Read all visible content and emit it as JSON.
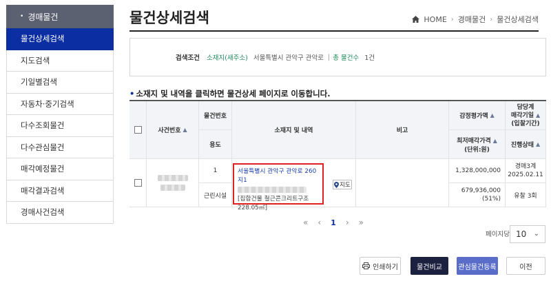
{
  "sidebar": {
    "header": "경매물건",
    "items": [
      {
        "label": "물건상세검색",
        "active": true
      },
      {
        "label": "지도검색"
      },
      {
        "label": "기일별검색"
      },
      {
        "label": "자동차·중기검색"
      },
      {
        "label": "다수조회물건"
      },
      {
        "label": "다수관심물건"
      },
      {
        "label": "매각예정물건"
      },
      {
        "label": "매각결과검색"
      },
      {
        "label": "경매사건검색"
      }
    ]
  },
  "header": {
    "title": "물건상세검색",
    "breadcrumb": [
      "HOME",
      "경매물건",
      "물건상세검색"
    ]
  },
  "search_condition": {
    "label": "검색조건",
    "location_key": "소재지(새주소)",
    "location_value": "서울특별시 관악구 관악로",
    "count_key": "총 물건수",
    "count_value": "1건"
  },
  "notice": "소재지 및 내역을 클릭하면 물건상세 페이지로 이동합니다.",
  "table": {
    "headers": {
      "case_no": "사건번호",
      "item_no": "물건번호",
      "usage": "용도",
      "address": "소재지 및 내역",
      "remarks": "비고",
      "appraisal": "감정평가액",
      "min_price": "최저매각가격",
      "min_price_unit": "(단위:원)",
      "manager": "담당계",
      "sale_date": "매각기일",
      "bid_period": "(입찰기간)",
      "status": "진행상태"
    },
    "row": {
      "item_no": "1",
      "usage": "근린시설",
      "address_line1": "서울특별시 관악구 관악로 260 지1",
      "address_desc": "[집합건물 철근콘크리트구조 228.05㎡]",
      "map_label": "지도",
      "appraisal": "1,328,000,000",
      "min_price": "679,936,000",
      "min_price_pct": "(51%)",
      "manager": "경매3계",
      "sale_date": "2025.02.11",
      "status": "유찰 3회"
    }
  },
  "pagination": {
    "first": "«",
    "prev": "‹",
    "current": "1",
    "next": "›",
    "last": "»",
    "per_page_label": "페이지당",
    "per_page_value": "10"
  },
  "buttons": {
    "print": "인쇄하기",
    "compare": "물건비교",
    "favorite": "관심물건등록",
    "previous": "이전"
  }
}
